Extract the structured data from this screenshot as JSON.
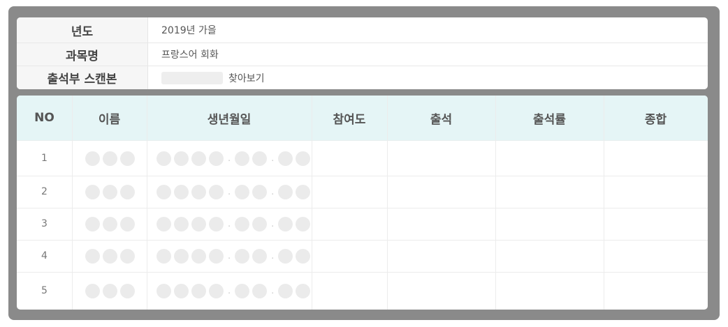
{
  "info": {
    "rows": [
      {
        "label": "년도",
        "value": "2019년 가을"
      },
      {
        "label": "과목명",
        "value": "프랑스어 회화"
      },
      {
        "label": "출석부 스캔본",
        "button": "찾아보기"
      }
    ]
  },
  "table": {
    "headers": [
      "NO",
      "이름",
      "생년월일",
      "참여도",
      "출석",
      "출석률",
      "종합"
    ],
    "rows": [
      {
        "no": "1"
      },
      {
        "no": "2"
      },
      {
        "no": "3"
      },
      {
        "no": "4"
      },
      {
        "no": "5"
      }
    ],
    "name_placeholder_dots": 3,
    "birth_placeholder_groups": [
      4,
      2,
      2
    ],
    "birth_separator": "."
  },
  "colors": {
    "frame": "#8a8a8a",
    "header_bg": "#e5f5f6",
    "label_bg": "#f6f6f6",
    "placeholder_dot": "#ebebeb"
  }
}
